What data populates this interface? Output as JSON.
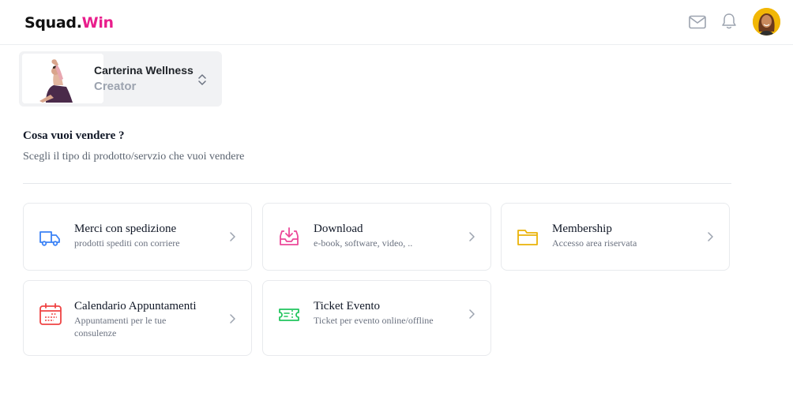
{
  "header": {
    "logo_part1": "Squad.",
    "logo_part2": "Win",
    "brand_color": "#e91e8c",
    "icons": [
      "mail-icon",
      "bell-icon"
    ]
  },
  "creator": {
    "name": "Carterina Wellness",
    "role": "Creator"
  },
  "section": {
    "title": "Cosa vuoi vendere ?",
    "subtitle": "Scegli il tipo di prodotto/servzio che vuoi vendere"
  },
  "products": [
    {
      "title": "Merci con spedizione",
      "desc": "prodotti spediti con corriere",
      "icon": "truck-icon",
      "color": "#3b82f6"
    },
    {
      "title": "Download",
      "desc": "e-book, software, video, ..",
      "icon": "inbox-download-icon",
      "color": "#ec4899"
    },
    {
      "title": "Membership",
      "desc": "Accesso area riservata",
      "icon": "folder-icon",
      "color": "#eab308"
    },
    {
      "title": "Calendario Appuntamenti",
      "desc": "Appuntamenti per le tue consulenze",
      "icon": "calendar-icon",
      "color": "#ef4444"
    },
    {
      "title": "Ticket Evento",
      "desc": "Ticket per evento online/offline",
      "icon": "ticket-icon",
      "color": "#22c55e"
    }
  ]
}
